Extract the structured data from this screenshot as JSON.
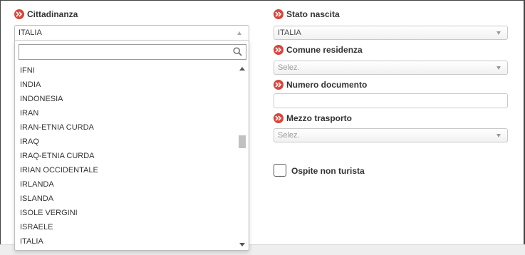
{
  "citizenship": {
    "label": "Cittadinanza",
    "selected": "ITALIA",
    "search_placeholder": "",
    "options": [
      "IFNI",
      "INDIA",
      "INDONESIA",
      "IRAN",
      "IRAN-ETNIA CURDA",
      "IRAQ",
      "IRAQ-ETNIA CURDA",
      "IRIAN OCCIDENTALE",
      "IRLANDA",
      "ISLANDA",
      "ISOLE VERGINI",
      "ISRAELE",
      "ITALIA"
    ]
  },
  "birth_state": {
    "label": "Stato nascita",
    "selected": "ITALIA"
  },
  "residence_municipality": {
    "label": "Comune residenza",
    "placeholder": "Selez."
  },
  "document_number": {
    "label": "Numero documento",
    "value": ""
  },
  "transport": {
    "label": "Mezzo trasporto",
    "placeholder": "Selez."
  },
  "non_tourist_guest": {
    "label": "Ospite non turista",
    "checked": false
  },
  "colors": {
    "required_badge": "#d9443a",
    "border": "#c9c9c9",
    "text": "#333333"
  },
  "icons": {
    "required": "double-chevron-right-icon",
    "search": "search-icon",
    "dropdown": "caret-down-icon"
  }
}
